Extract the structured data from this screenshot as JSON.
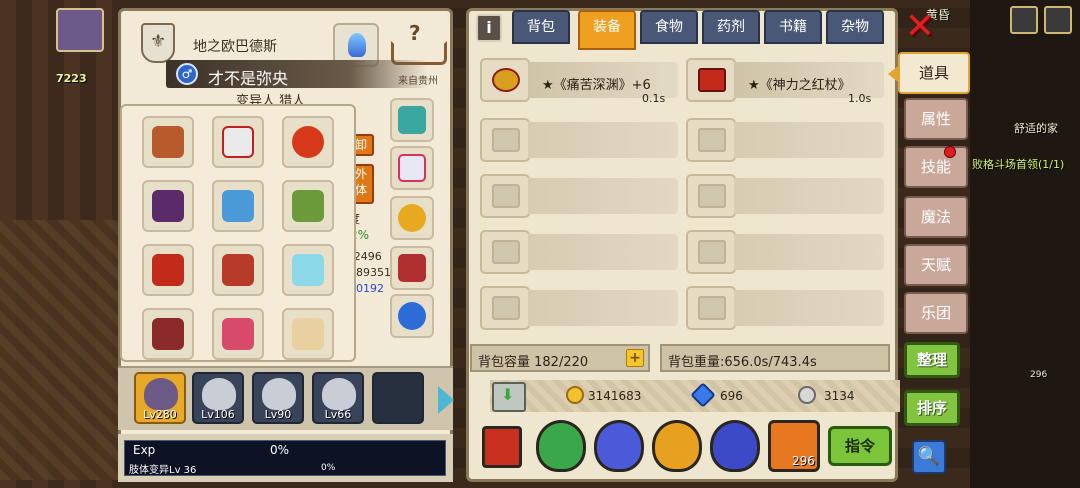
{
  "hud": {
    "gold_badge": "7223"
  },
  "character": {
    "guild": "地之欧巴德斯",
    "name": "才不是弥央",
    "origin": "来自贵州",
    "partial_texts": [
      "变异人 猎人",
      "度",
      "2%",
      "/2496",
      "89351",
      "0192"
    ],
    "stat_badges": [
      "卸",
      "外\n体"
    ]
  },
  "party": [
    {
      "label": "Lv280",
      "active": true
    },
    {
      "label": "Lv106",
      "active": false
    },
    {
      "label": "Lv90",
      "active": false
    },
    {
      "label": "Lv66",
      "active": false
    },
    {
      "label": "",
      "active": false
    }
  ],
  "exp": {
    "label": "Exp",
    "pct": "0%",
    "skill_label": "肢体变异Lv 36",
    "skill_pct": "0%"
  },
  "inventory": {
    "info_icon": "i",
    "tabs": [
      "背包",
      "装备",
      "食物",
      "药剂",
      "书籍",
      "杂物"
    ],
    "active_tab": "装备",
    "items": [
      {
        "name": "★《痛苦深渊》+6",
        "weight": "0.1s"
      },
      {
        "name": "★《神力之红杖》",
        "weight": "1.0s"
      }
    ],
    "capacity": "背包容量 182/220",
    "weight": "背包重量:656.0s/743.4s",
    "plus": "+",
    "gold": "3141683",
    "diamond": "696",
    "silver": "3134",
    "command": "指令",
    "potion_count": "296"
  },
  "side": {
    "close": "✕",
    "tabs": [
      "道具",
      "属性",
      "技能",
      "魔法",
      "天赋",
      "乐团"
    ],
    "organize": "整理",
    "sort": "排序",
    "search": "🔍"
  },
  "map": {
    "location": "舒适的家",
    "quest": "败格斗场首领(1/1)",
    "counter": "296",
    "top_text": "黄昏"
  },
  "colors": {
    "tab_active": "#f0a020",
    "tab_inactive": "#4a5878",
    "green_button": "#82c43f",
    "close_red": "#e01e1e"
  }
}
